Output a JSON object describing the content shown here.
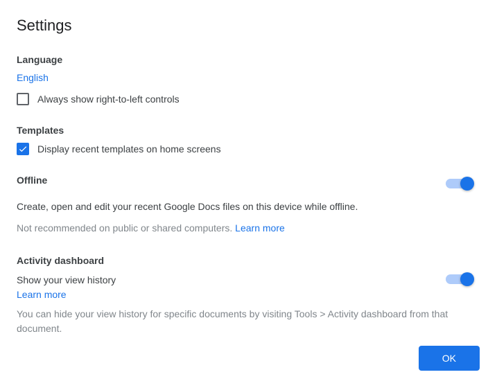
{
  "title": "Settings",
  "language": {
    "heading": "Language",
    "value": "English",
    "rtl_label": "Always show right-to-left controls",
    "rtl_checked": false
  },
  "templates": {
    "heading": "Templates",
    "display_label": "Display recent templates on home screens",
    "display_checked": true
  },
  "offline": {
    "heading": "Offline",
    "desc": "Create, open and edit your recent Google Docs files on this device while offline.",
    "warning": "Not recommended on public or shared computers. ",
    "learn_more": "Learn more",
    "enabled": true
  },
  "activity": {
    "heading": "Activity dashboard",
    "show_history": "Show your view history",
    "learn_more": "Learn more",
    "note": "You can hide your view history for specific documents by visiting Tools > Activity dashboard from that document.",
    "enabled": true
  },
  "footer": {
    "ok": "OK"
  }
}
